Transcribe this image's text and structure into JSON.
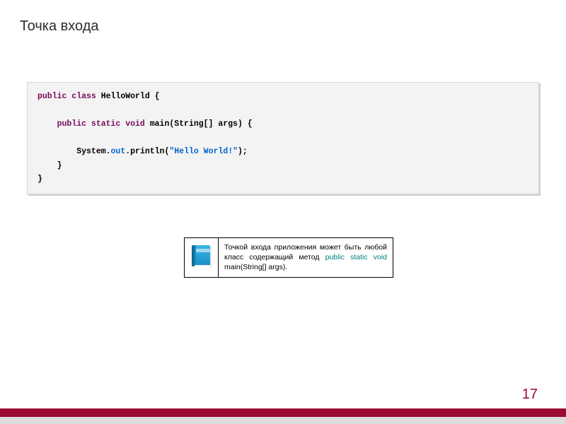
{
  "title": "Точка входа",
  "code": {
    "l1_kw": "public class ",
    "l1_cls": "HelloWorld {",
    "l2_kw": "public static void ",
    "l2_rest": "main(String[] args) {",
    "l3_a": "System.",
    "l3_out": "out",
    "l3_b": ".println(",
    "l3_str": "\"Hello World!\"",
    "l3_c": ");",
    "l4": "    }",
    "l5": "}"
  },
  "note": {
    "before": "Точкой входа приложения может быть любой класс содержащий метод ",
    "teal": "public static void",
    "after": " main(String[] args)."
  },
  "page_number": "17",
  "icons": {
    "book": "book-icon"
  }
}
